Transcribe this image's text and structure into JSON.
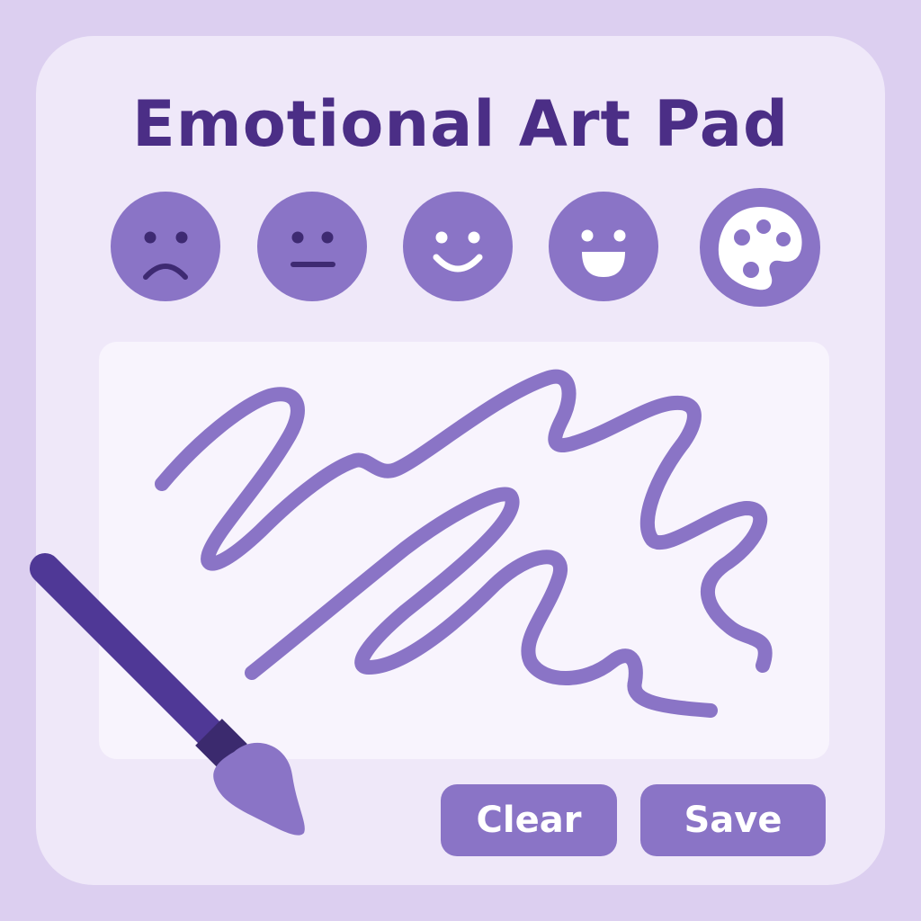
{
  "app": {
    "title": "Emotional Art Pad"
  },
  "moods": [
    {
      "name": "sad",
      "icon": "sad-face-icon"
    },
    {
      "name": "neutral",
      "icon": "neutral-face-icon"
    },
    {
      "name": "smile",
      "icon": "smile-face-icon"
    },
    {
      "name": "happy",
      "icon": "happy-face-icon"
    },
    {
      "name": "palette",
      "icon": "palette-icon"
    }
  ],
  "actions": {
    "clear_label": "Clear",
    "save_label": "Save"
  },
  "colors": {
    "background": "#dccff0",
    "panel": "#efe8f9",
    "canvas": "#f8f4fd",
    "accent": "#8a74c6",
    "title": "#4b2e86",
    "brush_handle": "#4f3896",
    "brush_ferrule": "#3b2a6e"
  }
}
